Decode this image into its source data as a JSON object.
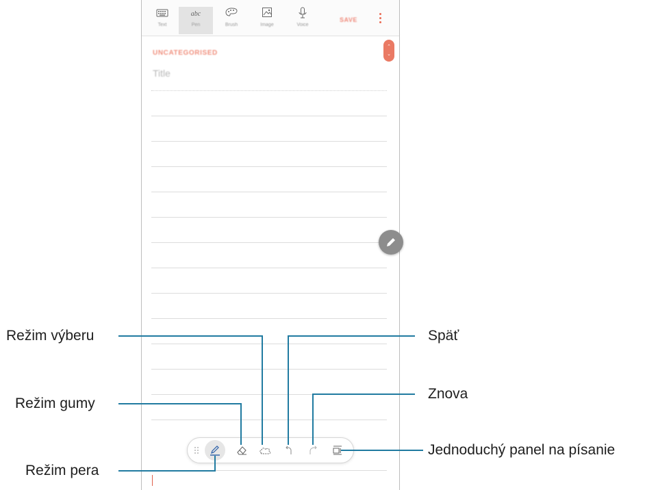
{
  "toolbar": {
    "buttons": [
      {
        "label": "Text",
        "icon": "keyboard-icon"
      },
      {
        "label": "Pen",
        "icon": "handwriting-icon"
      },
      {
        "label": "Brush",
        "icon": "palette-icon"
      },
      {
        "label": "Image",
        "icon": "image-icon"
      },
      {
        "label": "Voice",
        "icon": "microphone-icon"
      }
    ],
    "save_label": "SAVE",
    "more_icon": "more-vertical-icon"
  },
  "note": {
    "category": "UNCATEGORISED",
    "title_placeholder": "Title"
  },
  "pen_toolbar": {
    "items": [
      "drag-handle-icon",
      "pen-icon",
      "eraser-icon",
      "selection-icon",
      "undo-icon",
      "redo-icon",
      "simple-writing-pad-icon"
    ]
  },
  "callouts": {
    "selection_mode": "Režim výberu",
    "eraser_mode": "Režim gumy",
    "pen_mode": "Režim pera",
    "undo": "Späť",
    "redo": "Znova",
    "simple_pad": "Jednoduchý panel na písanie"
  },
  "colors": {
    "accent": "#ea6b55",
    "callout_line": "#1f7aa0",
    "pen_blue": "#2b5fa8"
  }
}
